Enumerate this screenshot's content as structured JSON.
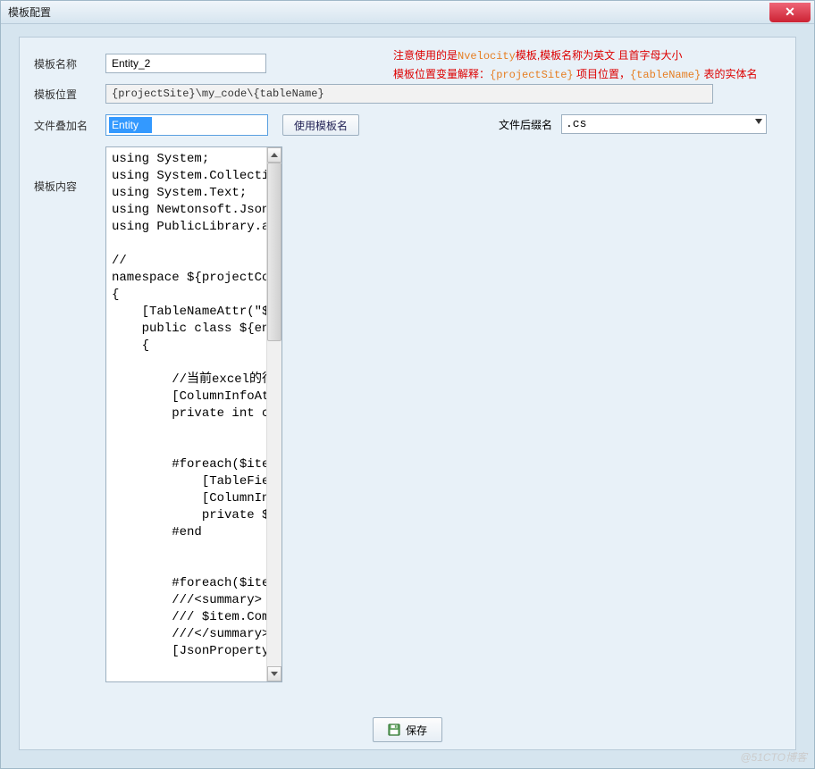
{
  "window": {
    "title": "模板配置"
  },
  "notes": {
    "line1_a": "注意使用的是",
    "line1_b": "Nvelocity",
    "line1_c": "模板,模板名称为英文 且首字母大小",
    "line2_a": "模板位置变量解释：",
    "line2_b": "{projectSite}",
    "line2_c": " 项目位置，",
    "line2_d": "{tableName}",
    "line2_e": " 表的实体名"
  },
  "labels": {
    "template_name": "模板名称",
    "template_location": "模板位置",
    "file_append": "文件叠加名",
    "file_ext": "文件后缀名",
    "template_content": "模板内容",
    "use_template_name": "使用模板名",
    "save": "保存"
  },
  "values": {
    "template_name": "Entity_2",
    "template_location": "{projectSite}\\my_code\\{tableName}",
    "file_append": "Entity",
    "file_ext": ".cs"
  },
  "code": "using System;\nusing System.Collections.Generic;\nusing System.Text;\nusing Newtonsoft.Json;\nusing PublicLibrary.attr;\n\n//\nnamespace ${projectCode.TopLevel}.entity\n{\n    [TableNameAttr(\"${tableName}\")]\n    public class ${entityName}\n    {\n\n        //当前excel的行\n        [ColumnInfoAttr(-10, 1000, true)]\n        private int curExcelIndex;\n\n\n        #foreach($item in $projectCode.TableFieldInfos)\n            [TableFieldAttr(\"$item.ColumnName\", null, null, true, true, null)]\n            [ColumnInfoAttr(-1, $item.MaxLength, false, null, \"\")]\n            private $item.GetJavaType() $item.GetEntityField();\n        #end\n\n\n        #foreach($item in $projectCode.TableFieldInfos)\n        ///<summary>\n        /// $item.Comment\n        ///</summary>\n        [JsonProperty(\"$item.GetEntityField()\")]",
  "watermark": "@51CTO博客"
}
